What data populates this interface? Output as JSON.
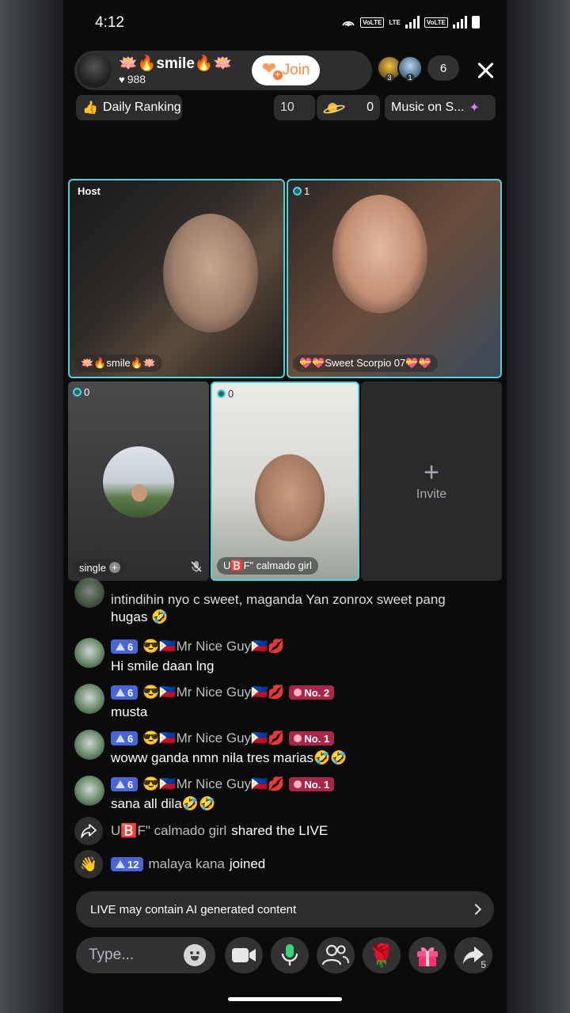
{
  "status_bar": {
    "time": "4:12",
    "volte1": "VoLTE",
    "lte": "LTE",
    "volte2": "VoLTE"
  },
  "header": {
    "host_name": "🪷🔥smile🔥🪷",
    "likes": "988",
    "join_label": "Join",
    "viewer_badges": [
      "3",
      "1"
    ],
    "viewer_count": "6"
  },
  "subheader": {
    "daily_ranking": "Daily Ranking",
    "count_a": "10",
    "planet_count": "0",
    "music": "Music on S..."
  },
  "tiles": {
    "host_tag": "Host",
    "host_name": "🪷🔥smile🔥🪷",
    "tile2_badge": "1",
    "tile2_name": "💝💝Sweet Scorpio 07💝💝",
    "tile3_badge": "0",
    "tile3_name": "single",
    "tile4_badge": "0",
    "tile4_name": "U🅱️F\" calmado girl",
    "invite_label": "Invite"
  },
  "chat": {
    "msg0_text_line1": "intindihin nyo c sweet, maganda Yan zonrox sweet pang",
    "msg0_text_line2": "hugas 🤣",
    "user_level": "6",
    "user_name": "😎🇵🇭Mr Nice Guy🇵🇭💋",
    "msg1_text": "Hi smile daan lng",
    "msg2_rank": "No. 2",
    "msg2_text": "musta",
    "msg3_rank": "No. 1",
    "msg3_text": "woww ganda nmn nila tres marias🤣🤣",
    "msg4_rank": "No. 1",
    "msg4_text": "sana all dila🤣🤣",
    "share_name": "U🅱️F\" calmado girl",
    "share_text": "shared the LIVE",
    "join_level": "12",
    "join_name": "malaya kana",
    "join_text": "joined"
  },
  "notice": "LIVE may contain AI generated content",
  "bottom": {
    "type_placeholder": "Type...",
    "share_count": "5"
  },
  "colors": {
    "accent_teal": "#4fd3d9",
    "join_orange": "#ff8a3d",
    "level_blue": "#4a66d6",
    "rank_red": "#a8264a"
  }
}
